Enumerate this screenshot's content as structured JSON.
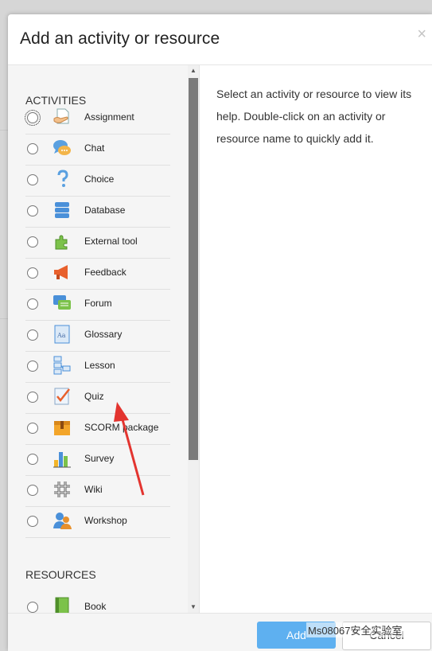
{
  "dialog": {
    "title": "Add an activity or resource",
    "close_glyph": "×"
  },
  "activities": {
    "heading": "ACTIVITIES",
    "items": [
      {
        "label": "Assignment",
        "icon": "assignment-icon"
      },
      {
        "label": "Chat",
        "icon": "chat-icon"
      },
      {
        "label": "Choice",
        "icon": "choice-icon"
      },
      {
        "label": "Database",
        "icon": "database-icon"
      },
      {
        "label": "External tool",
        "icon": "external-tool-icon"
      },
      {
        "label": "Feedback",
        "icon": "feedback-icon"
      },
      {
        "label": "Forum",
        "icon": "forum-icon"
      },
      {
        "label": "Glossary",
        "icon": "glossary-icon"
      },
      {
        "label": "Lesson",
        "icon": "lesson-icon"
      },
      {
        "label": "Quiz",
        "icon": "quiz-icon"
      },
      {
        "label": "SCORM package",
        "icon": "scorm-package-icon"
      },
      {
        "label": "Survey",
        "icon": "survey-icon"
      },
      {
        "label": "Wiki",
        "icon": "wiki-icon"
      },
      {
        "label": "Workshop",
        "icon": "workshop-icon"
      }
    ]
  },
  "resources": {
    "heading": "RESOURCES",
    "items": [
      {
        "label": "Book",
        "icon": "book-icon"
      }
    ]
  },
  "help": {
    "text": "Select an activity or resource to view its help. Double-click on an activity or resource name to quickly add it."
  },
  "footer": {
    "add_label": "Add",
    "cancel_label": "Cancel"
  },
  "watermark": {
    "text": "Ms08067安全实验室"
  },
  "colors": {
    "primary_button": "#5eb0f0",
    "annotation_arrow": "#e3342f"
  }
}
